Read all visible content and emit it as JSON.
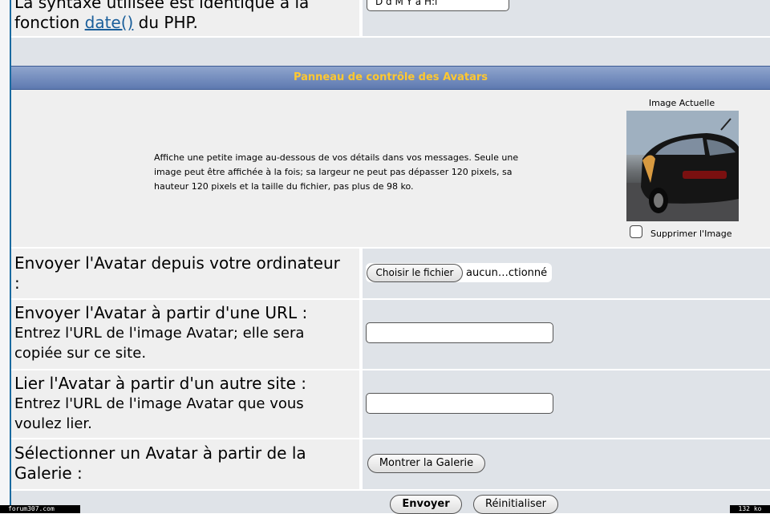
{
  "top_row": {
    "text_line1": "La syntaxe utilisée est identique à la",
    "text_line2_prefix": "fonction ",
    "link": "date()",
    "text_line2_suffix": " du PHP.",
    "input_value": "D d M Y à H:i"
  },
  "panel": {
    "title": "Panneau de contrôle des Avatars",
    "description_line1": "Affiche une petite image au-dessous de vos détails dans vos messages. Seule une",
    "description_line2": "image peut être affichée à la fois; sa largeur ne peut pas dépasser 120 pixels, sa",
    "description_line3": "hauteur 120 pixels et la taille du fichier, pas plus de 98 ko.",
    "current_image_label": "Image Actuelle",
    "delete_checkbox_label": "Supprimer l'Image",
    "delete_checked": false
  },
  "upload_row": {
    "label_line1": "Envoyer l'Avatar depuis votre ordinateur",
    "label_line2": ":",
    "choose_button": "Choisir le fichier",
    "file_status": "aucun…ctionné"
  },
  "url_row": {
    "label_line1": "Envoyer l'Avatar à partir d'une URL :",
    "label_line2": "Entrez l'URL de l'image Avatar; elle sera",
    "label_line3": "copiée sur ce site.",
    "input_value": ""
  },
  "link_row": {
    "label_line1": "Lier l'Avatar à partir d'un autre site :",
    "label_line2": "Entrez l'URL de l'image Avatar que vous",
    "label_line3": "voulez lier.",
    "input_value": ""
  },
  "gallery_row": {
    "label_line1": "Sélectionner un Avatar à partir de la",
    "label_line2": "Galerie :",
    "gallery_button": "Montrer la Galerie"
  },
  "actions": {
    "submit": "Envoyer",
    "reset": "Réinitialiser"
  },
  "status_bar": {
    "left": "forum307.com",
    "right": "132 ko"
  },
  "colors": {
    "header_text": "#ffc830",
    "link": "#1a5e9a",
    "left_cell": "#efefef",
    "right_cell": "#dfe3e8"
  }
}
